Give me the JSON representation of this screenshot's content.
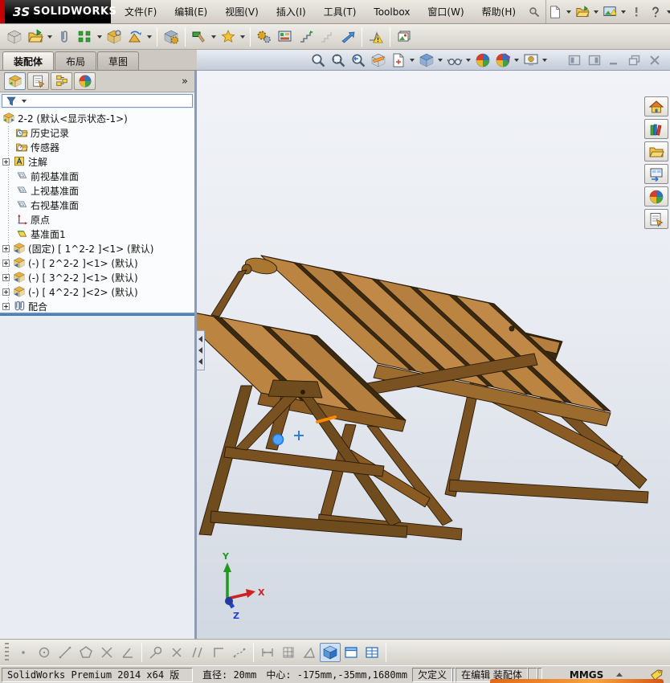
{
  "window": {
    "logo_mark": "3S",
    "logo_text": "SOLIDWORKS",
    "menu_items": [
      "文件(F)",
      "编辑(E)",
      "视图(V)",
      "插入(I)",
      "工具(T)",
      "Toolbox",
      "窗口(W)",
      "帮助(H)"
    ]
  },
  "command_manager": {
    "tabs": [
      "装配体",
      "布局",
      "草图"
    ],
    "active_tab": "装配体",
    "overflow_chevron": "»"
  },
  "main_toolbar_icons": [
    "edit-component",
    "insert-components",
    "mate",
    "linear-component-pattern",
    "smart-fasteners",
    "move-component",
    "show-hidden-components",
    "assembly-features",
    "reference-geometry",
    "assembly-xpert",
    "exploded-view",
    "explode-line-sketch",
    "interference-detection",
    "instant3d",
    "large-assembly-mode",
    "take-snapshot"
  ],
  "heads_up_icons": [
    "zoom-to-fit",
    "zoom-to-area",
    "previous-view",
    "section-view",
    "view-orientation",
    "display-style",
    "hide-show-items",
    "edit-appearance",
    "apply-scene",
    "view-settings"
  ],
  "feature_manager_tabs": [
    "feature-manager-design-tree",
    "property-manager",
    "configuration-manager",
    "display-manager"
  ],
  "task_pane_icons": [
    "solidworks-resources",
    "design-library",
    "file-explorer",
    "view-palette",
    "appearances-scenes",
    "custom-properties"
  ],
  "sketch_toolbar_icons": [
    "point",
    "circle",
    "line",
    "polygon",
    "trim",
    "sketch-angle",
    "tangent-arc",
    "mirror-entities",
    "parallel",
    "corner-rectangle",
    "spline",
    "smart-dimension",
    "grid-snap",
    "measure-angle",
    "shaded-view",
    "viewport-pane",
    "viewport-table"
  ],
  "tree": {
    "root_label": "2-2  (默认<显示状态-1>)",
    "items": [
      {
        "label": "历史记录"
      },
      {
        "label": "传感器"
      },
      {
        "label": "注解"
      },
      {
        "label": "前视基准面"
      },
      {
        "label": "上视基准面"
      },
      {
        "label": "右视基准面"
      },
      {
        "label": "原点"
      },
      {
        "label": "基准面1"
      },
      {
        "label": "(固定) [ 1^2-2 ]<1> (默认)"
      },
      {
        "label": "(-) [ 2^2-2 ]<1> (默认)"
      },
      {
        "label": "(-) [ 3^2-2 ]<1> (默认)"
      },
      {
        "label": "(-) [ 4^2-2 ]<2> (默认)"
      },
      {
        "label": "配合"
      }
    ]
  },
  "viewport": {
    "model": "convertible wooden picnic table assembly",
    "triad": {
      "x": "X",
      "y": "Y",
      "z": "Z"
    }
  },
  "status": {
    "version": "SolidWorks Premium 2014 x64 版",
    "diameter": "直径: 20mm",
    "center": "中心: -175mm,-35mm,1680mm",
    "definition": "欠定义",
    "editing": "在编辑 装配体",
    "units": "MMGS"
  },
  "colors": {
    "logo_red": "#c40000",
    "titlebar_black": "#111111",
    "chrome_gray": "#d6d3ce",
    "viewport_top": "#f1f3f8",
    "viewport_bottom": "#d2d8e2",
    "wood_light": "#bb8440",
    "wood_mid": "#9c6b2e",
    "wood_dark": "#6f4c1d",
    "wood_outline": "#2a1c08",
    "selection_blue": "#4da3ff",
    "highlight_orange": "#ff8800",
    "splitter_blue": "#3b6ea5"
  }
}
